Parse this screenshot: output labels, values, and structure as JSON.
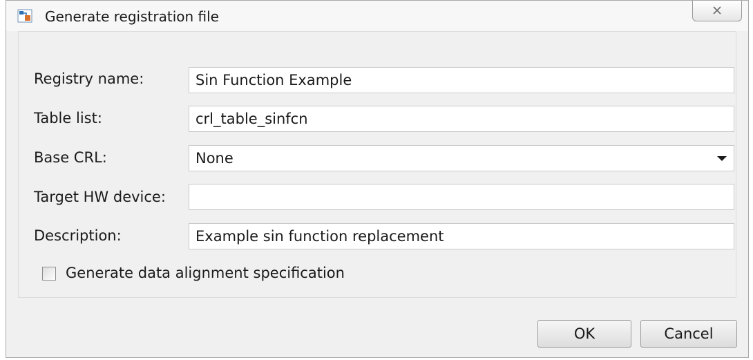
{
  "window": {
    "title": "Generate registration file"
  },
  "form": {
    "registry_name": {
      "label": "Registry name:",
      "value": "Sin Function Example"
    },
    "table_list": {
      "label": "Table list:",
      "value": "crl_table_sinfcn"
    },
    "base_crl": {
      "label": "Base CRL:",
      "value": "None"
    },
    "target_hw_device": {
      "label": "Target HW device:",
      "value": ""
    },
    "description": {
      "label": "Description:",
      "value": "Example sin function replacement"
    },
    "data_alignment": {
      "label": "Generate data alignment specification",
      "checked": false
    }
  },
  "buttons": {
    "ok": "OK",
    "cancel": "Cancel"
  },
  "icons": {
    "app": "simulink-app-icon",
    "close": "close-icon",
    "dropdown": "chevron-down-icon"
  }
}
